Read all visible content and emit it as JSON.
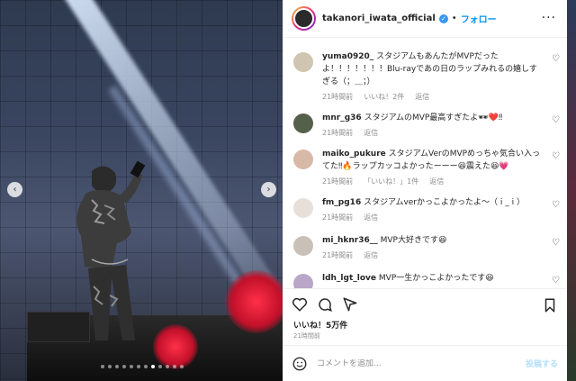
{
  "post": {
    "username": "takanori_iwata_official",
    "follow_label": "フォロー",
    "separator": "•"
  },
  "comments": [
    {
      "user": "yuma0920_",
      "text": "スタジアムもあんたがMVPだったよ！！！！！！！Blu-rayであの日のラップみれるの嬉しすぎる（；＿；）",
      "time": "21時間前",
      "likes": "いいね！2件",
      "reply": "返信",
      "avatar_color": "#cfc5b0"
    },
    {
      "user": "mnr_g36",
      "text": "スタジアムのMVP最高すぎたよ🕶❤️‼",
      "time": "21時間前",
      "likes": "",
      "reply": "返信",
      "avatar_color": "#55604a"
    },
    {
      "user": "maiko_pukure",
      "text": "スタジアムVerのMVPめっちゃ気合い入ってた‼🔥ラップカッコよかったーーー😆震えた😆💗",
      "time": "21時間前",
      "likes": "「いいね！」1件",
      "reply": "返信",
      "avatar_color": "#d8b9a8"
    },
    {
      "user": "fm_pg16",
      "text": "スタジアムverかっこよかったよ〜（ i _ i ）",
      "time": "21時間前",
      "likes": "",
      "reply": "返信",
      "avatar_color": "#e8e0d8"
    },
    {
      "user": "mi_hknr36__",
      "text": "MVP大好きです😆",
      "time": "21時間前",
      "likes": "",
      "reply": "返信",
      "avatar_color": "#c9c1b8"
    },
    {
      "user": "ldh_lgt_love",
      "text": "MVP一生かっこよかったです😆",
      "time": "",
      "likes": "",
      "reply": "",
      "avatar_color": "#b9a6c8"
    }
  ],
  "likes_label": "いいね！5万件",
  "time_label": "21時間前",
  "input": {
    "placeholder": "コメントを追加...",
    "post_label": "投稿する"
  },
  "carousel": {
    "total": 12,
    "active": 7
  }
}
